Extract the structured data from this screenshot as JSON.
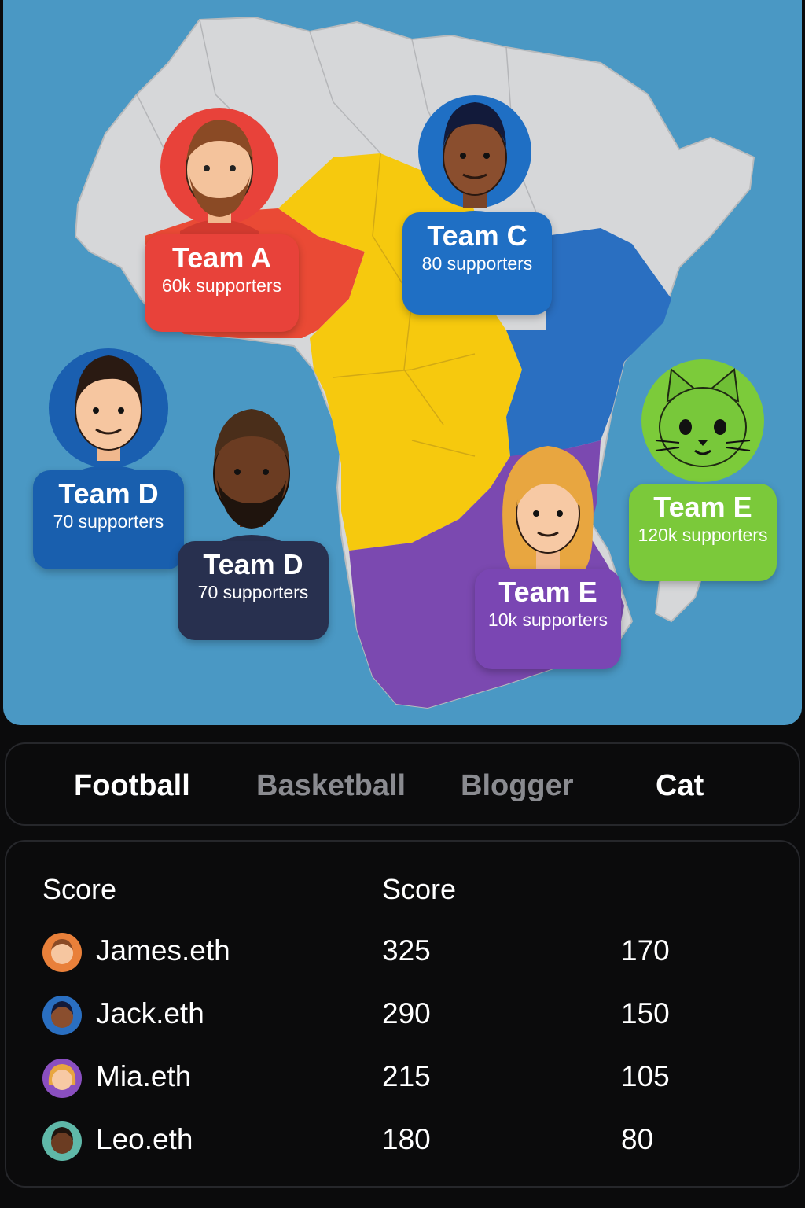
{
  "map": {
    "ocean_color": "#4a98c4",
    "land_color": "#d6d7d9",
    "markers": [
      {
        "name": "Team A",
        "supporters": "60k supporters",
        "color": "#e8423a",
        "avatar": "bearded-man-avatar"
      },
      {
        "name": "Team C",
        "supporters": "80 supporters",
        "color": "#1f6fc4",
        "avatar": "dark-skinned-man-avatar"
      },
      {
        "name": "Team D",
        "supporters": "70 supporters",
        "color": "#195fae",
        "avatar": "young-man-avatar"
      },
      {
        "name": "Team D",
        "supporters": "70 supporters",
        "color": "#28304f",
        "avatar": "bearded-dark-man-avatar"
      },
      {
        "name": "Team E",
        "supporters": "10k supporters",
        "color": "#7a46b3",
        "avatar": "blonde-woman-avatar"
      },
      {
        "name": "Team E",
        "supporters": "120k supporters",
        "color": "#7bc93a",
        "avatar": "green-cat-avatar"
      }
    ]
  },
  "tabs": [
    {
      "label": "Football",
      "active": true
    },
    {
      "label": "Basketball",
      "active": false
    },
    {
      "label": "Blogger",
      "active": false
    },
    {
      "label": "Cat",
      "active": true
    }
  ],
  "leaderboard": {
    "headers": [
      "Score",
      "Score"
    ],
    "rows": [
      {
        "user": "James.eth",
        "avatar": "james-avatar",
        "score1": "325",
        "score2": "170"
      },
      {
        "user": "Jack.eth",
        "avatar": "jack-avatar",
        "score1": "290",
        "score2": "150"
      },
      {
        "user": "Mia.eth",
        "avatar": "mia-avatar",
        "score1": "215",
        "score2": "105"
      },
      {
        "user": "Leo.eth",
        "avatar": "leo-avatar",
        "score1": "180",
        "score2": "80"
      }
    ]
  }
}
